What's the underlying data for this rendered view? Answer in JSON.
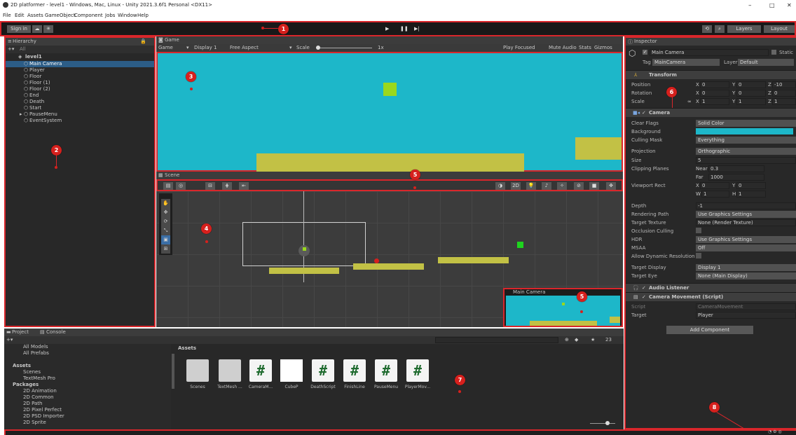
{
  "window": {
    "title": "2D platformer - level1 - Windows, Mac, Linux - Unity 2021.3.6f1 Personal <DX11>",
    "controls": [
      "–",
      "□",
      "✕"
    ]
  },
  "menu": [
    "File",
    "Edit",
    "Assets",
    "GameObject",
    "Component",
    "Jobs",
    "Window",
    "Help"
  ],
  "toolbar": {
    "sign_in": "Sign in",
    "layers": "Layers",
    "layout": "Layout",
    "play": "▶",
    "pause": "❚❚",
    "step": "▶|"
  },
  "badges": [
    "1",
    "2",
    "3",
    "4",
    "5",
    "5",
    "6",
    "7",
    "8"
  ],
  "hierarchy": {
    "tab": "Hierarchy",
    "search_placeholder": "All",
    "scene": "level1",
    "items": [
      "Main Camera",
      "Player",
      "Floor",
      "Floor (1)",
      "Floor (2)",
      "End",
      "Death",
      "Start",
      "PauseMenu",
      "EventSystem"
    ]
  },
  "game": {
    "tab": "Game",
    "mode": "Game",
    "display": "Display 1",
    "aspect": "Free Aspect",
    "scale_label": "Scale",
    "scale_value": "1x",
    "play_focused": "Play Focused",
    "mute": "Mute Audio",
    "stats": "Stats",
    "gizmos": "Gizmos",
    "bg_color": "#1db7c9"
  },
  "scene": {
    "tab": "Scene",
    "bg_color": "#3c3c3c",
    "camera_preview_title": "Main Camera",
    "tools": [
      "✋",
      "✥",
      "⟳",
      "⤡",
      "▣",
      "⊞"
    ]
  },
  "inspector": {
    "tab": "Inspector",
    "object_name": "Main Camera",
    "static_label": "Static",
    "tag_label": "Tag",
    "tag_value": "MainCamera",
    "layer_label": "Layer",
    "layer_value": "Default",
    "transform": {
      "title": "Transform",
      "position": "Position",
      "rotation": "Rotation",
      "scale": "Scale",
      "pos": [
        "0",
        "0",
        "-10"
      ],
      "rot": [
        "0",
        "0",
        "0"
      ],
      "scl": [
        "1",
        "1",
        "1"
      ]
    },
    "camera": {
      "title": "Camera",
      "clear_flags": "Clear Flags",
      "clear_flags_v": "Solid Color",
      "background": "Background",
      "culling_mask": "Culling Mask",
      "culling_mask_v": "Everything",
      "projection": "Projection",
      "projection_v": "Orthographic",
      "size": "Size",
      "size_v": "5",
      "clipping": "Clipping Planes",
      "near_label": "Near",
      "near_v": "0.3",
      "far_label": "Far",
      "far_v": "1000",
      "viewport": "Viewport Rect",
      "vp_x": "0",
      "vp_y": "0",
      "vp_w": "1",
      "vp_h": "1",
      "depth": "Depth",
      "depth_v": "-1",
      "rendering_path": "Rendering Path",
      "rendering_path_v": "Use Graphics Settings",
      "target_texture": "Target Texture",
      "target_texture_v": "None (Render Texture)",
      "occlusion": "Occlusion Culling",
      "hdr": "HDR",
      "hdr_v": "Use Graphics Settings",
      "msaa": "MSAA",
      "msaa_v": "Off",
      "dyn_res": "Allow Dynamic Resolution",
      "target_display": "Target Display",
      "target_display_v": "Display 1",
      "target_eye": "Target Eye",
      "target_eye_v": "None (Main Display)"
    },
    "audio_listener": "Audio Listener",
    "camera_movement": {
      "title": "Camera Movement (Script)",
      "script_label": "Script",
      "script_value": "CameraMovement",
      "target_label": "Target",
      "target_value": "Player"
    },
    "add_component": "Add Component"
  },
  "project": {
    "tab_project": "Project",
    "tab_console": "Console",
    "count": "23",
    "tree": [
      "All Models",
      "All Prefabs",
      "Assets",
      "Scenes",
      "TextMesh Pro",
      "Packages",
      "2D Animation",
      "2D Common",
      "2D Path",
      "2D Pixel Perfect",
      "2D PSD Importer",
      "2D Sprite"
    ],
    "breadcrumb": "Assets",
    "assets": [
      "Scenes",
      "TextMesh ...",
      "CameraM...",
      "CubeP",
      "DeathScript",
      "FinishLine",
      "PauseMenu",
      "PlayerMov..."
    ]
  }
}
